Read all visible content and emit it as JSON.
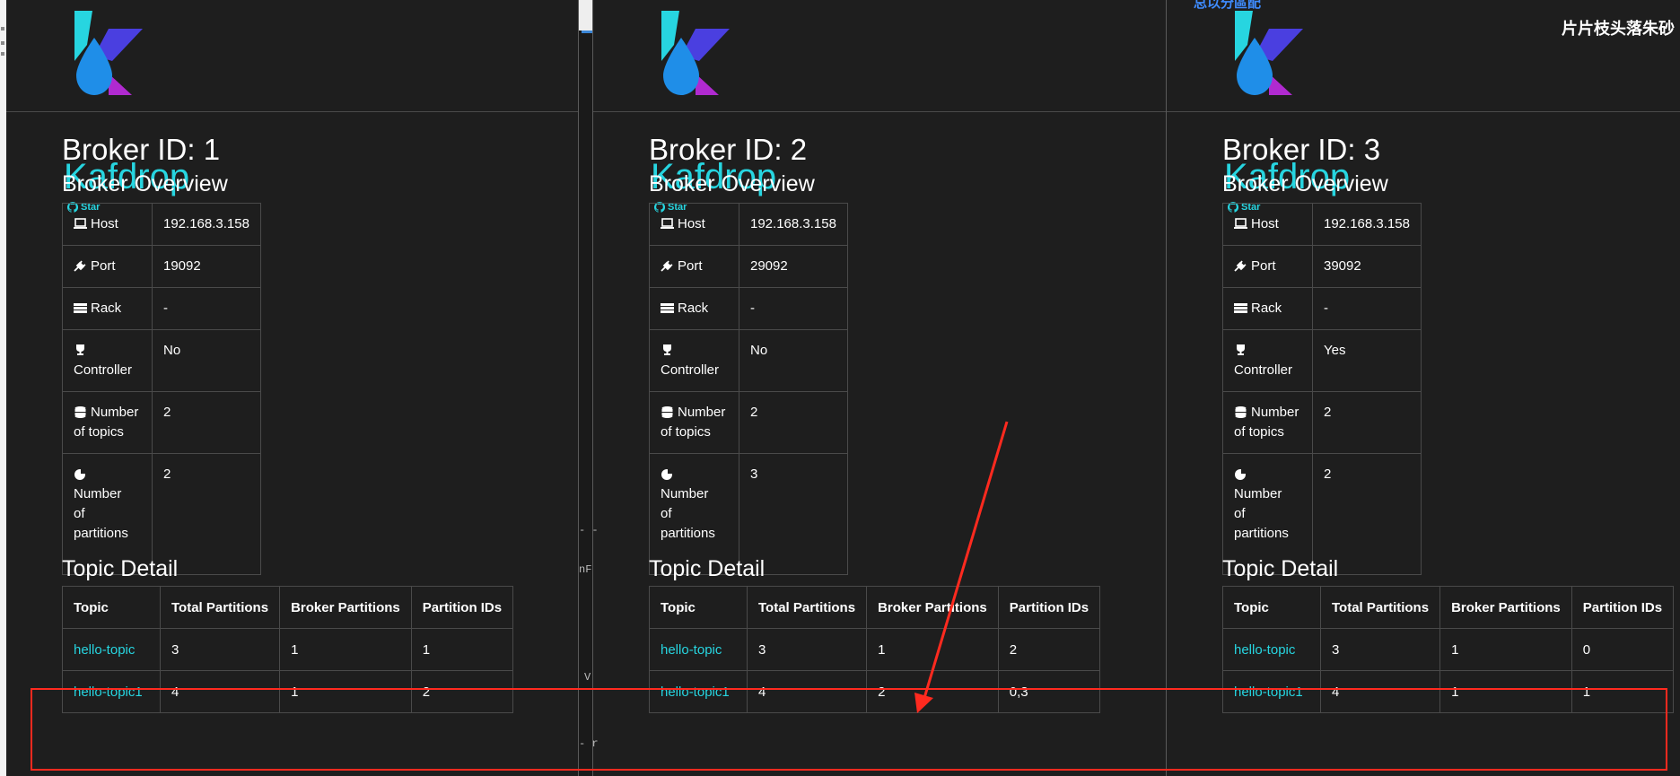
{
  "panels": [
    {
      "brand": "Kafdrop",
      "star_label": "Star",
      "broker_title": "Broker ID: 1",
      "overview_title": "Broker Overview",
      "overview": {
        "host_label": "Host",
        "host": "192.168.3.158",
        "port_label": "Port",
        "port": "19092",
        "rack_label": "Rack",
        "rack": "-",
        "controller_label": "Controller",
        "controller": "No",
        "topics_label_1": "Number",
        "topics_label_2": "of topics",
        "topics": "2",
        "partitions_label_1": "Number",
        "partitions_label_2": "of",
        "partitions_label_3": "partitions",
        "partitions": "2"
      },
      "topic_detail_title": "Topic Detail",
      "columns": [
        "Topic",
        "Total Partitions",
        "Broker Partitions",
        "Partition IDs"
      ],
      "rows": [
        {
          "topic": "hello-topic",
          "total": "3",
          "broker": "1",
          "ids": "1"
        },
        {
          "topic": "hello-topic1",
          "total": "4",
          "broker": "1",
          "ids": "2"
        }
      ]
    },
    {
      "brand": "Kafdrop",
      "star_label": "Star",
      "broker_title": "Broker ID: 2",
      "overview_title": "Broker Overview",
      "overview": {
        "host_label": "Host",
        "host": "192.168.3.158",
        "port_label": "Port",
        "port": "29092",
        "rack_label": "Rack",
        "rack": "-",
        "controller_label": "Controller",
        "controller": "No",
        "topics_label_1": "Number",
        "topics_label_2": "of topics",
        "topics": "2",
        "partitions_label_1": "Number",
        "partitions_label_2": "of",
        "partitions_label_3": "partitions",
        "partitions": "3"
      },
      "topic_detail_title": "Topic Detail",
      "columns": [
        "Topic",
        "Total Partitions",
        "Broker Partitions",
        "Partition IDs"
      ],
      "rows": [
        {
          "topic": "hello-topic",
          "total": "3",
          "broker": "1",
          "ids": "2"
        },
        {
          "topic": "hello-topic1",
          "total": "4",
          "broker": "2",
          "ids": "0,3"
        }
      ]
    },
    {
      "brand": "Kafdrop",
      "star_label": "Star",
      "broker_title": "Broker ID: 3",
      "overview_title": "Broker Overview",
      "overview": {
        "host_label": "Host",
        "host": "192.168.3.158",
        "port_label": "Port",
        "port": "39092",
        "rack_label": "Rack",
        "rack": "-",
        "controller_label": "Controller",
        "controller": "Yes",
        "topics_label_1": "Number",
        "topics_label_2": "of topics",
        "topics": "2",
        "partitions_label_1": "Number",
        "partitions_label_2": "of",
        "partitions_label_3": "partitions",
        "partitions": "2"
      },
      "topic_detail_title": "Topic Detail",
      "columns": [
        "Topic",
        "Total Partitions",
        "Broker Partitions",
        "Partition IDs"
      ],
      "rows": [
        {
          "topic": "hello-topic",
          "total": "3",
          "broker": "1",
          "ids": "0"
        },
        {
          "topic": "hello-topic1",
          "total": "4",
          "broker": "1",
          "ids": "1"
        }
      ]
    }
  ],
  "overlay": {
    "cjk_top": "总以分區配",
    "cjk_right": "片片枝头落朱砂"
  },
  "gutter_text": {
    "a": "- -",
    "b": "nF",
    "c": "V",
    "d": "- r"
  },
  "colors": {
    "accent": "#27d5e0",
    "annotation": "#ff2a1f",
    "background": "#1e1e1e"
  },
  "icons": [
    "laptop-icon",
    "plug-icon",
    "server-icon",
    "trophy-icon",
    "database-icon",
    "pie-chart-icon",
    "github-icon",
    "kafdrop-logo-icon"
  ]
}
